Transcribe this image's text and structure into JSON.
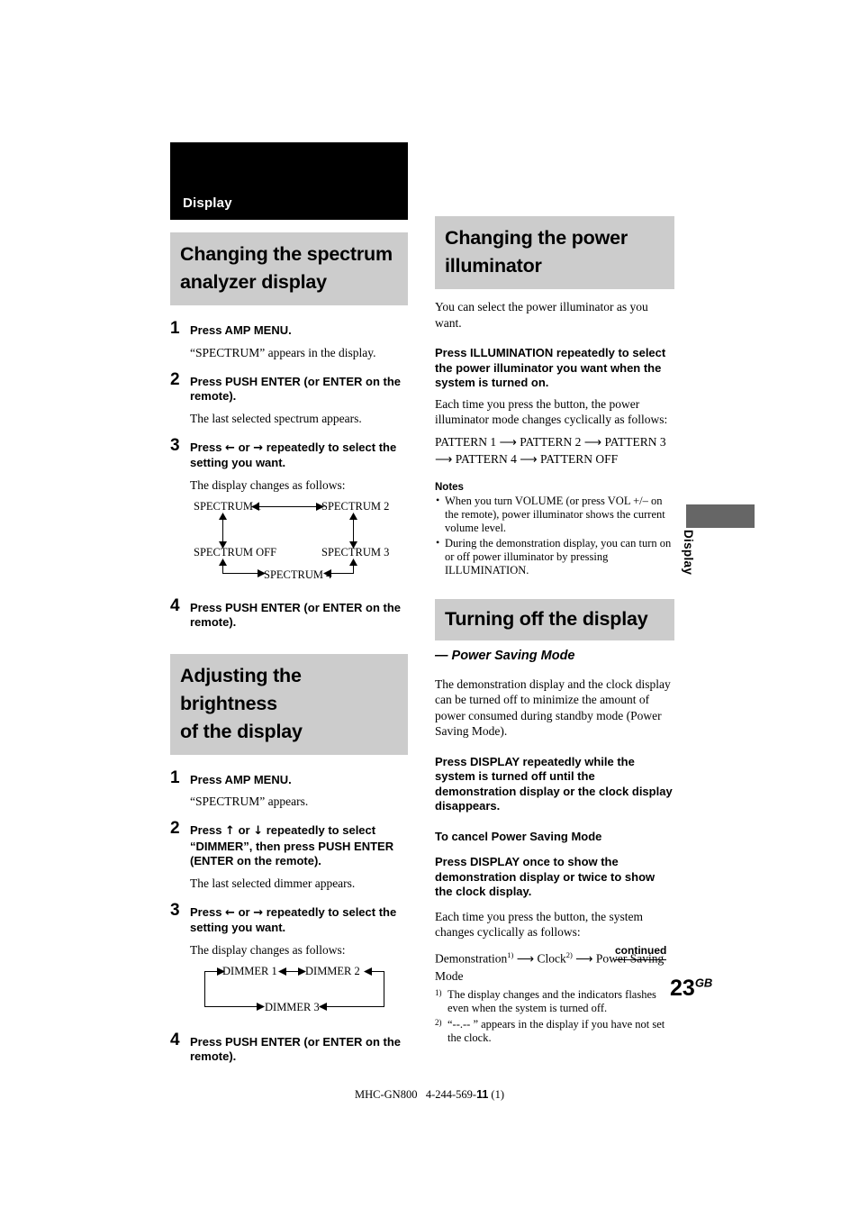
{
  "document": {
    "chapter_tab": "Display",
    "side_tab": "Display",
    "page_number": "23",
    "page_number_sup": "GB",
    "continued": "continued",
    "footer_model": "MHC-GN800",
    "footer_partnum_a": "4-244-569-",
    "footer_partnum_b": "11",
    "footer_partnum_c": " (1)"
  },
  "left_column": {
    "section1": {
      "heading_line1": "Changing the spectrum",
      "heading_line2": "analyzer display",
      "steps": [
        {
          "num": "1",
          "title": "Press AMP MENU.",
          "body": "“SPECTRUM” appears in the display."
        },
        {
          "num": "2",
          "title": "Press PUSH ENTER (or ENTER on the remote).",
          "body": "The last selected spectrum appears."
        },
        {
          "num": "3",
          "title_pre": "Press ",
          "title_arrow_left": "←",
          "title_mid": " or ",
          "title_arrow_right": "→",
          "title_post": " repeatedly to select the setting you want.",
          "body": "The display changes as follows:"
        },
        {
          "num": "4",
          "title": "Press PUSH ENTER (or ENTER on the remote).",
          "body": ""
        }
      ],
      "flow": {
        "spectrum_1": "SPECTRUM 1",
        "spectrum_2": "SPECTRUM 2",
        "spectrum_off": "SPECTRUM OFF",
        "spectrum_3": "SPECTRUM 3",
        "spectrum_4": "SPECTRUM 4"
      }
    },
    "section2": {
      "heading_line1": "Adjusting the brightness",
      "heading_line2": "of the display",
      "steps": [
        {
          "num": "1",
          "title": "Press AMP MENU.",
          "body": "“SPECTRUM” appears."
        },
        {
          "num": "2",
          "title_pre": "Press ",
          "title_arrow_up": "↑",
          "title_mid": " or ",
          "title_arrow_down": "↓",
          "title_post": " repeatedly to select “DIMMER”, then press PUSH ENTER (ENTER on the remote).",
          "body": "The last selected dimmer appears."
        },
        {
          "num": "3",
          "title_pre": "Press ",
          "title_arrow_left": "←",
          "title_mid": " or ",
          "title_arrow_right": "→",
          "title_post": " repeatedly to select the setting you want.",
          "body": "The display changes as follows:"
        },
        {
          "num": "4",
          "title": "Press PUSH ENTER (or ENTER on the remote).",
          "body": ""
        }
      ],
      "flow": {
        "dimmer_1": "DIMMER 1",
        "dimmer_2": "DIMMER 2",
        "dimmer_3": "DIMMER 3"
      }
    }
  },
  "right_column": {
    "section1": {
      "heading_line1": "Changing the power",
      "heading_line2": "illuminator",
      "intro": "You can select the power illuminator as you want.",
      "bold_lead": "Press ILLUMINATION repeatedly to select the power illuminator you want when the system is turned on.",
      "after_lead": "Each time you press the button, the power illuminator mode changes cyclically as follows:",
      "pattern_cycle_line1": "PATTERN 1 ⟶ PATTERN 2 ⟶ PATTERN 3",
      "pattern_cycle_line2": "⟶ PATTERN 4 ⟶ PATTERN OFF",
      "notes_title": "Notes",
      "notes": [
        "When you turn VOLUME (or press VOL +/– on the remote), power illuminator shows the current volume level.",
        "During the demonstration display, you can turn on or off power illuminator by pressing ILLUMINATION."
      ]
    },
    "section2": {
      "heading": "Turning off the display",
      "subheading": "— Power Saving Mode",
      "para1": "The demonstration display and the clock display can be turned off to minimize the amount of power consumed during standby mode (Power Saving Mode).",
      "bold_lead1": "Press DISPLAY repeatedly while the system is turned off until the demonstration display or the clock display disappears.",
      "subhead_cancel": "To cancel Power Saving Mode",
      "bold_lead2": "Press DISPLAY once to show the demonstration display or twice to show the clock display.",
      "para2": "Each time you press the button, the system changes cyclically as follows:",
      "cycle_demo": "Demonstration",
      "cycle_demo_sup": "1)",
      "cycle_arrow1": " ⟶ ",
      "cycle_clock": "Clock",
      "cycle_clock_sup": "2)",
      "cycle_arrow2": " ⟶ ",
      "cycle_psm": "Power Saving Mode",
      "footnotes": [
        {
          "mark": "1)",
          "text": "The display changes and the indicators flashes even when the system is turned off."
        },
        {
          "mark": "2)",
          "text": "“--.-- ” appears in the display if you have not set the clock."
        }
      ]
    }
  }
}
